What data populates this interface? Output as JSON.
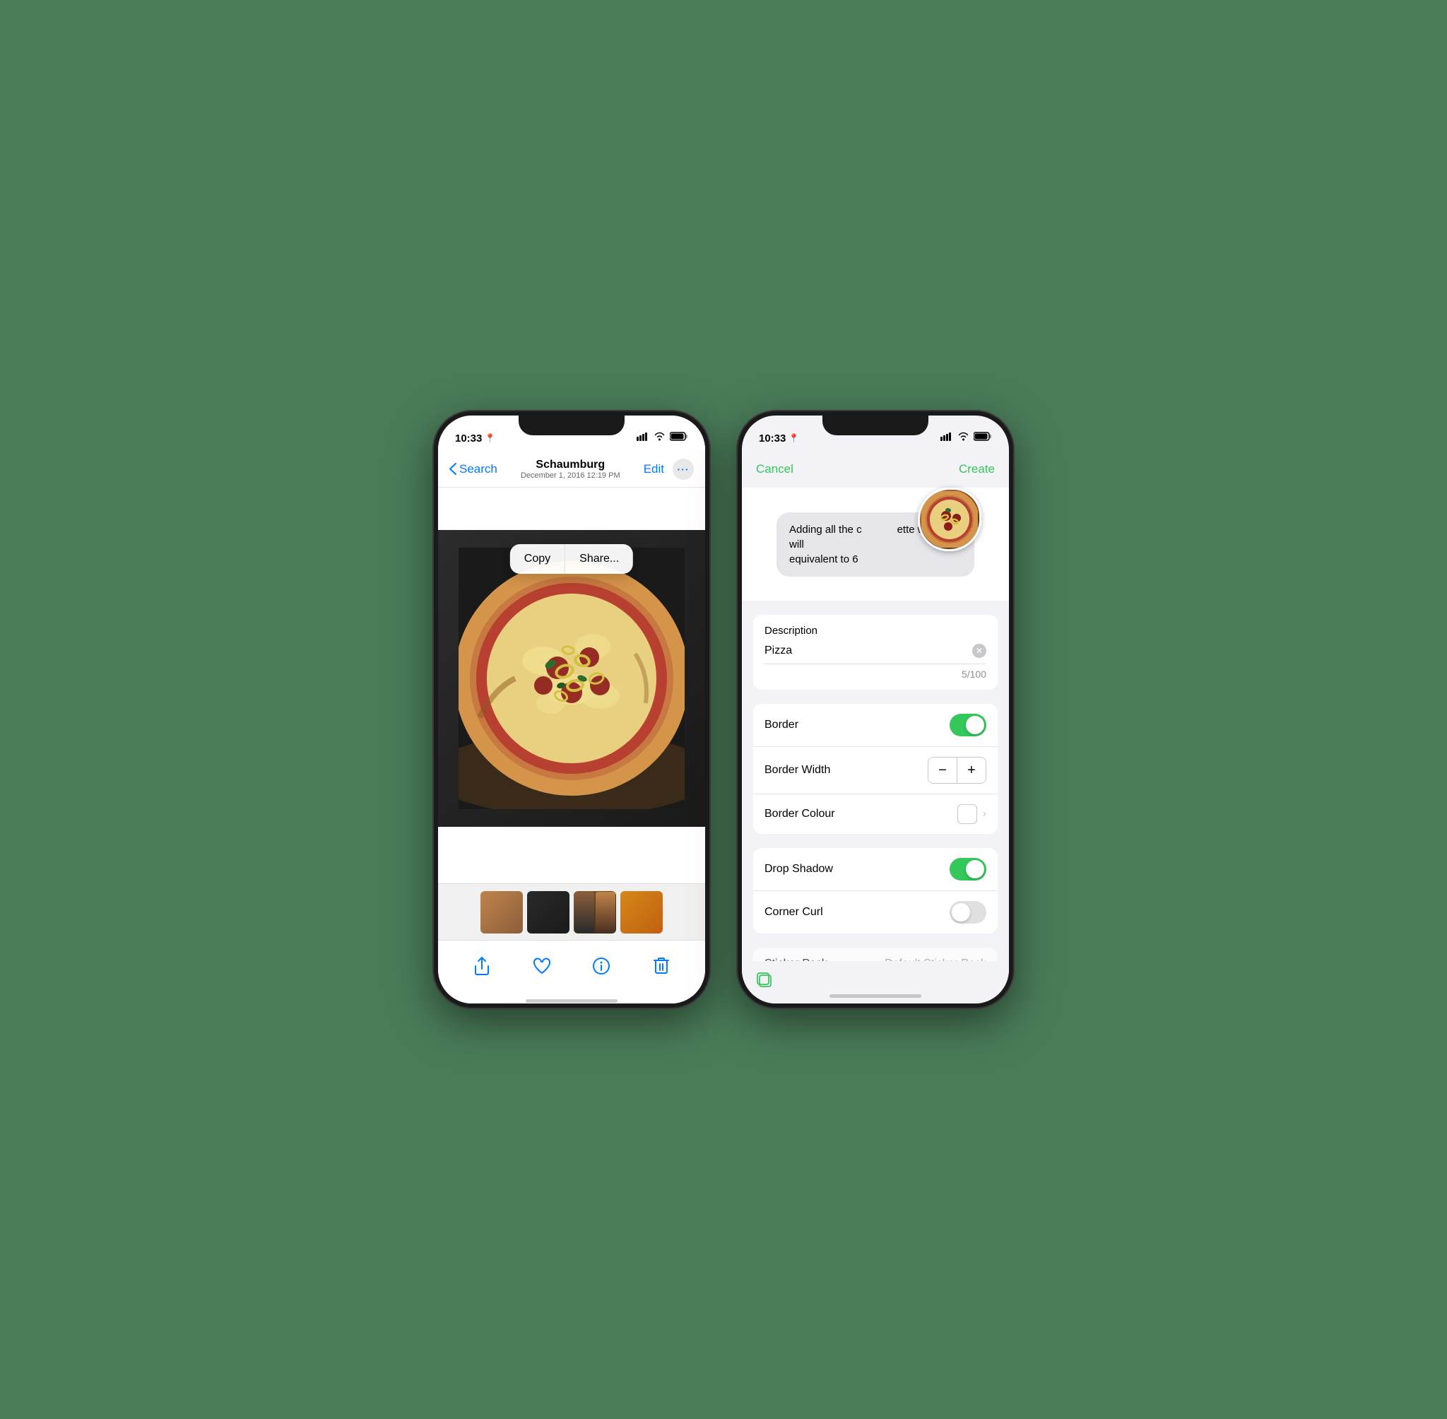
{
  "phone1": {
    "status": {
      "time": "10:33",
      "location_icon": "📍",
      "signal": "▌▌▌▌",
      "wifi": "wifi",
      "battery": "battery"
    },
    "nav": {
      "back_label": "Search",
      "title": "Schaumburg",
      "subtitle": "December 1, 2016  12:19 PM",
      "edit_label": "Edit",
      "more_icon": "•••"
    },
    "context_menu": {
      "copy_label": "Copy",
      "share_label": "Share..."
    },
    "toolbar": {
      "share_icon": "share",
      "heart_icon": "heart",
      "info_icon": "info",
      "trash_icon": "trash"
    }
  },
  "phone2": {
    "status": {
      "time": "10:33",
      "location_icon": "📍"
    },
    "nav": {
      "cancel_label": "Cancel",
      "create_label": "Create"
    },
    "preview": {
      "message_text": "Adding all the c          ette wheel will equivalent to 6"
    },
    "form": {
      "description_label": "Description",
      "description_value": "Pizza",
      "description_placeholder": "Pizza",
      "description_count": "5/100",
      "border_label": "Border",
      "border_width_label": "Border Width",
      "border_colour_label": "Border Colour",
      "drop_shadow_label": "Drop Shadow",
      "corner_curl_label": "Corner Curl",
      "sticker_pack_label": "Sticker Pack",
      "sticker_pack_value": "Default Sticker Pack"
    },
    "stepper": {
      "minus_label": "−",
      "plus_label": "+"
    }
  }
}
